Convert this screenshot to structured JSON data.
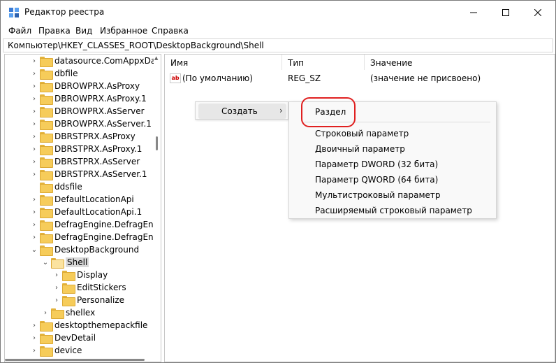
{
  "window": {
    "title": "Редактор реестра",
    "controls": [
      "minimize-icon",
      "maximize-icon",
      "close-icon"
    ]
  },
  "menu": [
    "Файл",
    "Правка",
    "Вид",
    "Избранное",
    "Справка"
  ],
  "address": "Компьютер\\HKEY_CLASSES_ROOT\\DesktopBackground\\Shell",
  "tree": [
    {
      "label": "datasource.ComAppxDat",
      "level": 0,
      "expander": "collapsed"
    },
    {
      "label": "dbfile",
      "level": 0,
      "expander": "collapsed"
    },
    {
      "label": "DBROWPRX.AsProxy",
      "level": 0,
      "expander": "collapsed"
    },
    {
      "label": "DBROWPRX.AsProxy.1",
      "level": 0,
      "expander": "collapsed"
    },
    {
      "label": "DBROWPRX.AsServer",
      "level": 0,
      "expander": "collapsed"
    },
    {
      "label": "DBROWPRX.AsServer.1",
      "level": 0,
      "expander": "collapsed"
    },
    {
      "label": "DBRSTPRX.AsProxy",
      "level": 0,
      "expander": "collapsed"
    },
    {
      "label": "DBRSTPRX.AsProxy.1",
      "level": 0,
      "expander": "collapsed"
    },
    {
      "label": "DBRSTPRX.AsServer",
      "level": 0,
      "expander": "collapsed"
    },
    {
      "label": "DBRSTPRX.AsServer.1",
      "level": 0,
      "expander": "collapsed"
    },
    {
      "label": "ddsfile",
      "level": 0,
      "expander": "none"
    },
    {
      "label": "DefaultLocationApi",
      "level": 0,
      "expander": "collapsed"
    },
    {
      "label": "DefaultLocationApi.1",
      "level": 0,
      "expander": "collapsed"
    },
    {
      "label": "DefragEngine.DefragEngi",
      "level": 0,
      "expander": "collapsed"
    },
    {
      "label": "DefragEngine.DefragEngi",
      "level": 0,
      "expander": "collapsed"
    },
    {
      "label": "DesktopBackground",
      "level": 0,
      "expander": "expanded"
    },
    {
      "label": "Shell",
      "level": 1,
      "expander": "expanded",
      "selected": true
    },
    {
      "label": "Display",
      "level": 2,
      "expander": "collapsed"
    },
    {
      "label": "EditStickers",
      "level": 2,
      "expander": "collapsed"
    },
    {
      "label": "Personalize",
      "level": 2,
      "expander": "collapsed"
    },
    {
      "label": "shellex",
      "level": 1,
      "expander": "collapsed"
    },
    {
      "label": "desktopthemepackfile",
      "level": 0,
      "expander": "collapsed"
    },
    {
      "label": "DevDetail",
      "level": 0,
      "expander": "collapsed"
    },
    {
      "label": "device",
      "level": 0,
      "expander": "collapsed"
    }
  ],
  "list": {
    "columns": [
      "Имя",
      "Тип",
      "Значение"
    ],
    "rows": [
      {
        "name": "(По умолчанию)",
        "type": "REG_SZ",
        "value": "(значение не присвоено)",
        "icon": "ab-string-icon"
      }
    ]
  },
  "context_menu": {
    "item": "Создать",
    "arrow": "›"
  },
  "submenu": [
    "Раздел",
    "Строковый параметр",
    "Двоичный параметр",
    "Параметр DWORD (32 бита)",
    "Параметр QWORD (64 бита)",
    "Мультистроковый параметр",
    "Расширяемый строковый параметр"
  ],
  "colors": {
    "highlight_ring": "#e02020",
    "folder": "#f6cc5a",
    "selection": "#d9d9d9"
  }
}
